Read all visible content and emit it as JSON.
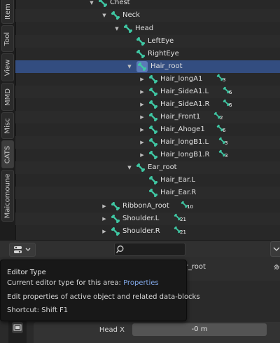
{
  "sidebar": {
    "tabs": [
      "Item",
      "Tool",
      "View",
      "MMD",
      "Misc",
      "CATS",
      "Maicomoune"
    ]
  },
  "outliner": {
    "rows": [
      {
        "label": "Chest",
        "count": ""
      },
      {
        "label": "Neck",
        "count": ""
      },
      {
        "label": "Head",
        "count": ""
      },
      {
        "label": "LeftEye",
        "count": ""
      },
      {
        "label": "RightEye",
        "count": ""
      },
      {
        "label": "Hair_root",
        "count": ""
      },
      {
        "label": "Hair_longA1",
        "count": "3"
      },
      {
        "label": "Hair_SideA1.L",
        "count": "6"
      },
      {
        "label": "Hair_SideA1.R",
        "count": "6"
      },
      {
        "label": "Hair_Front1",
        "count": "2"
      },
      {
        "label": "Hair_Ahoge1",
        "count": "6"
      },
      {
        "label": "Hair_longB1.L",
        "count": "3"
      },
      {
        "label": "Hair_longB1.R",
        "count": "3"
      },
      {
        "label": "Ear_root",
        "count": ""
      },
      {
        "label": "Hair_Ear.L",
        "count": ""
      },
      {
        "label": "Hair_Ear.R",
        "count": ""
      },
      {
        "label": "RibbonA_root",
        "count": "10"
      },
      {
        "label": "Shoulder.L",
        "count": "21"
      },
      {
        "label": "Shoulder.R",
        "count": "21"
      }
    ]
  },
  "properties": {
    "bone_name_partial": "ir_root",
    "head_x_label": "Head X",
    "head_x_value": "-0 m"
  },
  "tooltip": {
    "title": "Editor Type",
    "line_prefix": "Current editor type for this area:",
    "line_value": "Properties",
    "description": "Edit properties of active object and related data-blocks",
    "shortcut": "Shortcut: Shift F1"
  },
  "colors": {
    "bone": "#3fc8a4",
    "selected_row": "#334d80",
    "tooltip_value": "#82a8e8"
  }
}
